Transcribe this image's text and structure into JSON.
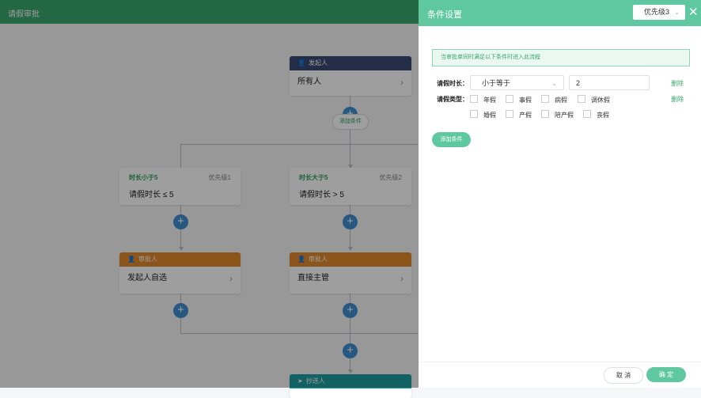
{
  "app": {
    "title": "请假审批"
  },
  "flow": {
    "initiator": {
      "header": "发起人",
      "body": "所有人"
    },
    "add_condition_label": "添加条件",
    "branches": [
      {
        "condition_name": "时长小于5",
        "priority": "优先级1",
        "condition_text": "请假时长 ≤ 5",
        "approver": {
          "header": "审批人",
          "body": "发起人自选"
        }
      },
      {
        "condition_name": "时长大于5",
        "priority": "优先级2",
        "condition_text": "请假时长 > 5",
        "approver": {
          "header": "审批人",
          "body": "直接主管"
        }
      }
    ],
    "cc": {
      "header": "抄送人"
    },
    "colors": {
      "initiator": "#3b4a74",
      "approver": "#e08a2e",
      "cc": "#1f9ea0",
      "add": "#3e8fd0"
    }
  },
  "panel": {
    "title": "条件设置",
    "priority_select": "优先级3",
    "tip": "当审批单同时满足以下条件时进入此流程",
    "duration": {
      "label": "请假时长：",
      "operator": "小于等于",
      "value": "2",
      "delete": "删除"
    },
    "leave_type": {
      "label": "请假类型：",
      "delete": "删除",
      "options": [
        "年假",
        "事假",
        "病假",
        "调休假",
        "婚假",
        "产假",
        "陪产假",
        "丧假"
      ]
    },
    "add_condition_button": "添加条件",
    "cancel": "取 消",
    "ok": "确 定",
    "accent": "#60c8a0"
  }
}
